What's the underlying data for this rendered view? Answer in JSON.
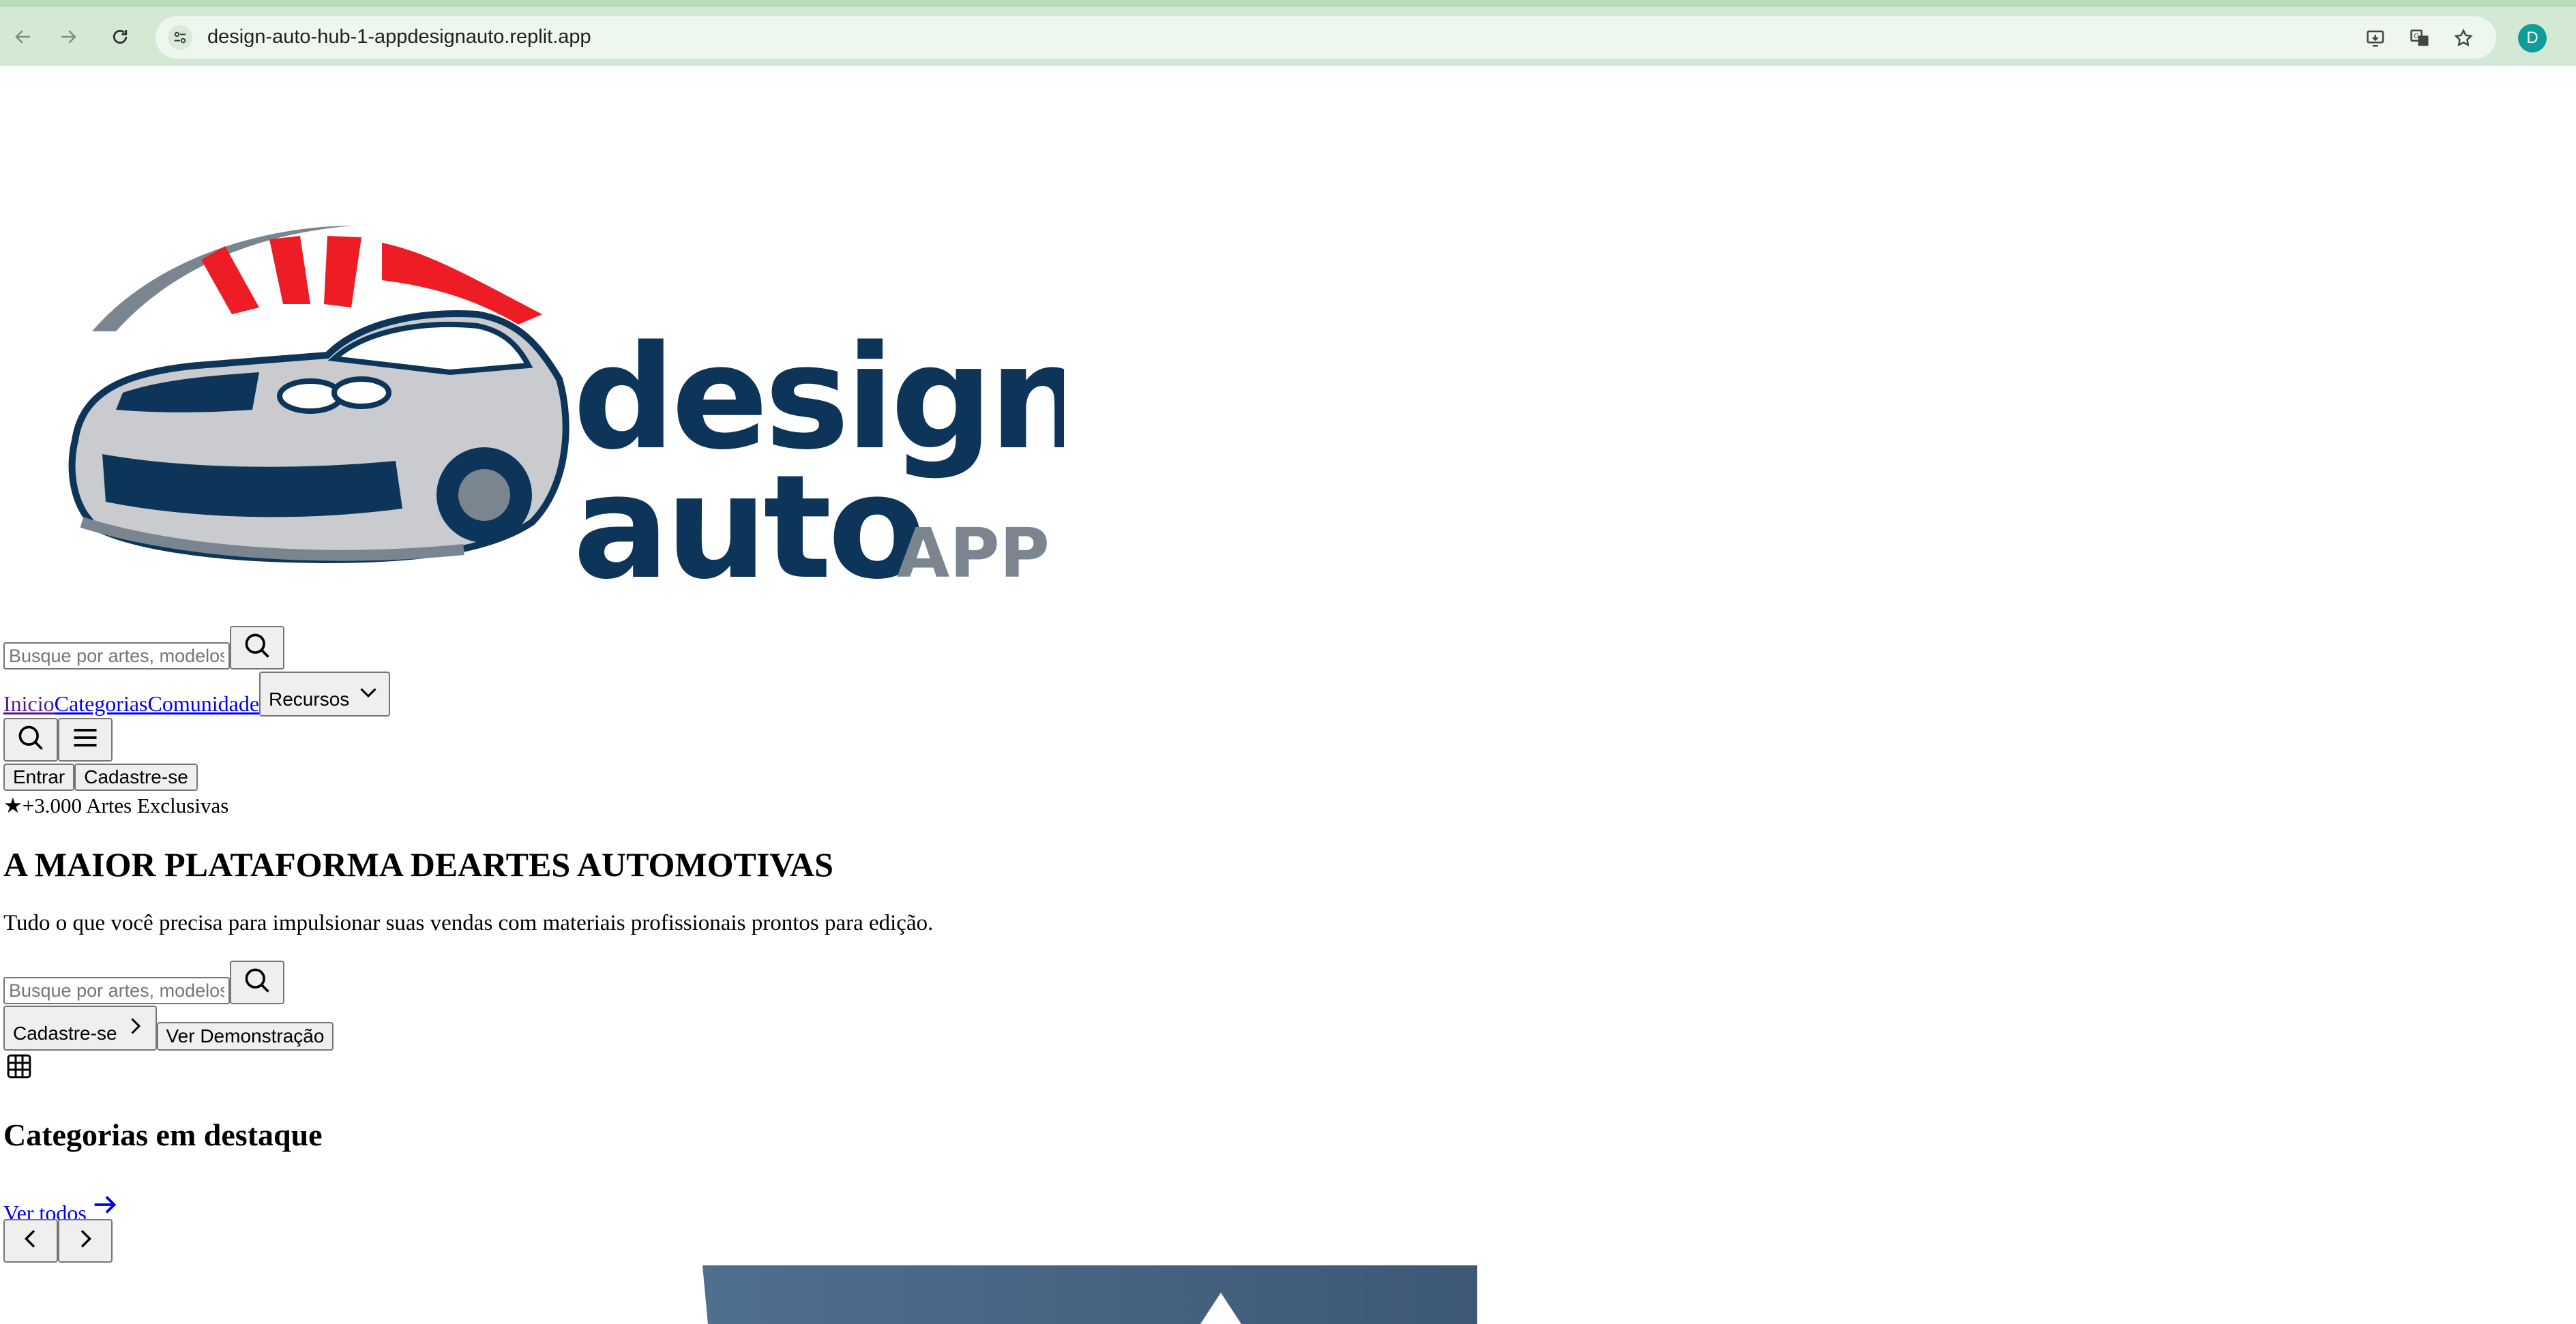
{
  "browser": {
    "url": "design-auto-hub-1-appdesignauto.replit.app",
    "profile_initial": "D"
  },
  "logo": {
    "line1": "design",
    "line2": "auto",
    "suffix": "APP"
  },
  "header": {
    "search_placeholder": "Busque por artes, modelos,",
    "nav": {
      "inicio": "Inicio",
      "categorias": "Categorias",
      "comunidade": "Comunidade",
      "recursos": "Recursos"
    },
    "login_label": "Entrar",
    "signup_label": "Cadastre-se"
  },
  "hero": {
    "badge_star": "★",
    "badge_text": "+3.000 Artes Exclusivas",
    "title": "A MAIOR PLATAFORMA DEARTES AUTOMOTIVAS",
    "subtitle": "Tudo o que você precisa para impulsionar suas vendas com materiais profissionais prontos para edição.",
    "search_placeholder": "Busque por artes, modelos,",
    "signup_label": "Cadastre-se",
    "demo_label": "Ver Demonstração"
  },
  "categories": {
    "title": "Categorias em destaque",
    "see_all": "Ver todos"
  },
  "colors": {
    "logo_navy": "#0d3559",
    "logo_red": "#ee1c24",
    "logo_gray": "#7b8590",
    "chrome_green": "#d3e9d3"
  }
}
